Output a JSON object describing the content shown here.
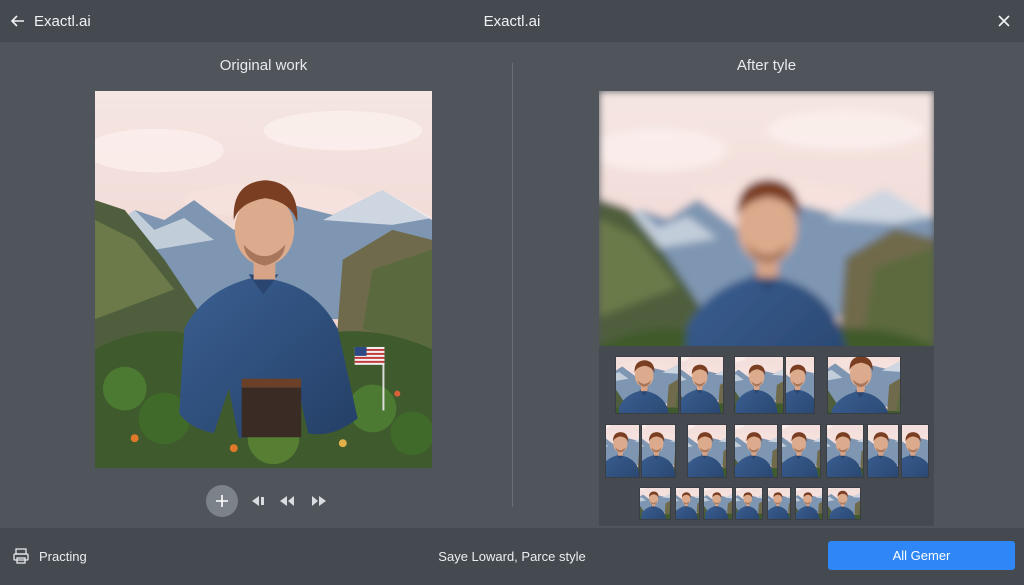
{
  "topbar": {
    "app_name": "Exactl.ai",
    "title": "Exactl.ai",
    "back_icon": "arrow-left-icon",
    "close_icon": "close-icon"
  },
  "left_pane": {
    "title": "Original work"
  },
  "right_pane": {
    "title": "After tyle"
  },
  "controls": {
    "add_icon": "plus-icon",
    "buttons": [
      "prev-frame-icon",
      "rewind-icon",
      "forward-icon"
    ]
  },
  "bottombar": {
    "status_icon": "printer-icon",
    "status_text": "Practing",
    "center_text": "Saye Loward, Parce style",
    "primary_button": "All Gemer"
  },
  "colors": {
    "accent": "#2f86f6",
    "shirt": "#2e4f7e",
    "sky": "#f2dcd6",
    "mountains": "#6e8aa8"
  }
}
